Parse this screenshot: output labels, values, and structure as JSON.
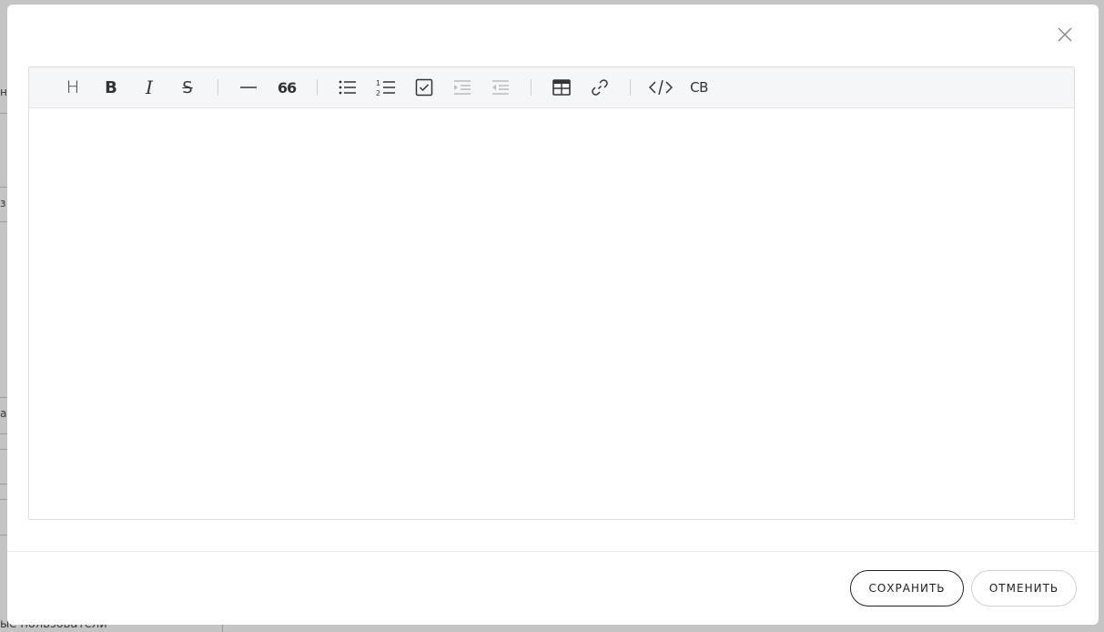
{
  "background": {
    "fragments": [
      "н",
      "з",
      "а"
    ],
    "bottom_text": "ые пользователи"
  },
  "toolbar": {
    "heading": "H",
    "bold": "B",
    "italic": "I",
    "strike": "S",
    "quote": "66",
    "code_block": "CB"
  },
  "editor": {
    "content": ""
  },
  "footer": {
    "save_label": "СОХРАНИТЬ",
    "cancel_label": "ОТМЕНИТЬ"
  }
}
